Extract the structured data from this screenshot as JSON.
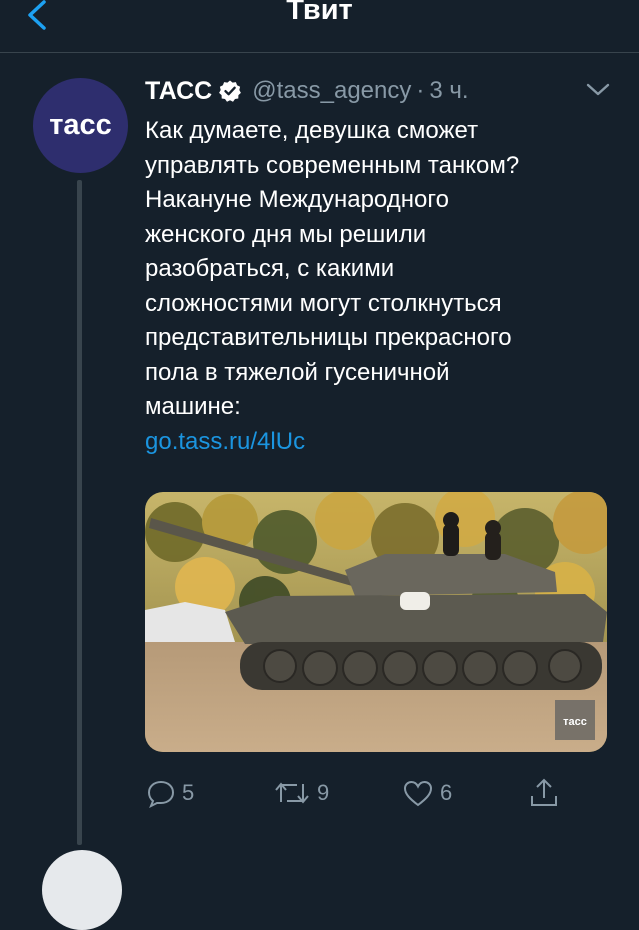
{
  "header": {
    "title": "Твит",
    "back_icon": "chevron-left-icon"
  },
  "tweet": {
    "avatar_text": "тасс",
    "author_name": "ТАСС",
    "verified_icon": "verified-badge-icon",
    "handle": "@tass_agency",
    "separator": "·",
    "time": "3 ч.",
    "text_lines": [
      "Как думаете, девушка сможет",
      "управлять современным танком?",
      "Накануне Международного",
      "женского дня мы решили",
      "разобраться, с какими",
      "сложностями могут столкнуться",
      "представительницы прекрасного",
      "пола в тяжелой гусеничной",
      "машине:"
    ],
    "link": "go.tass.ru/4lUc",
    "media": {
      "icon": "tank-photo",
      "watermark": "тасс"
    },
    "actions": {
      "reply_count": "5",
      "retweet_count": "9",
      "like_count": "6"
    }
  },
  "colors": {
    "background": "#15202b",
    "link": "#1b95e0",
    "muted": "#8899a6",
    "divider": "#38444d",
    "avatar_bg": "#2e2e6e"
  }
}
